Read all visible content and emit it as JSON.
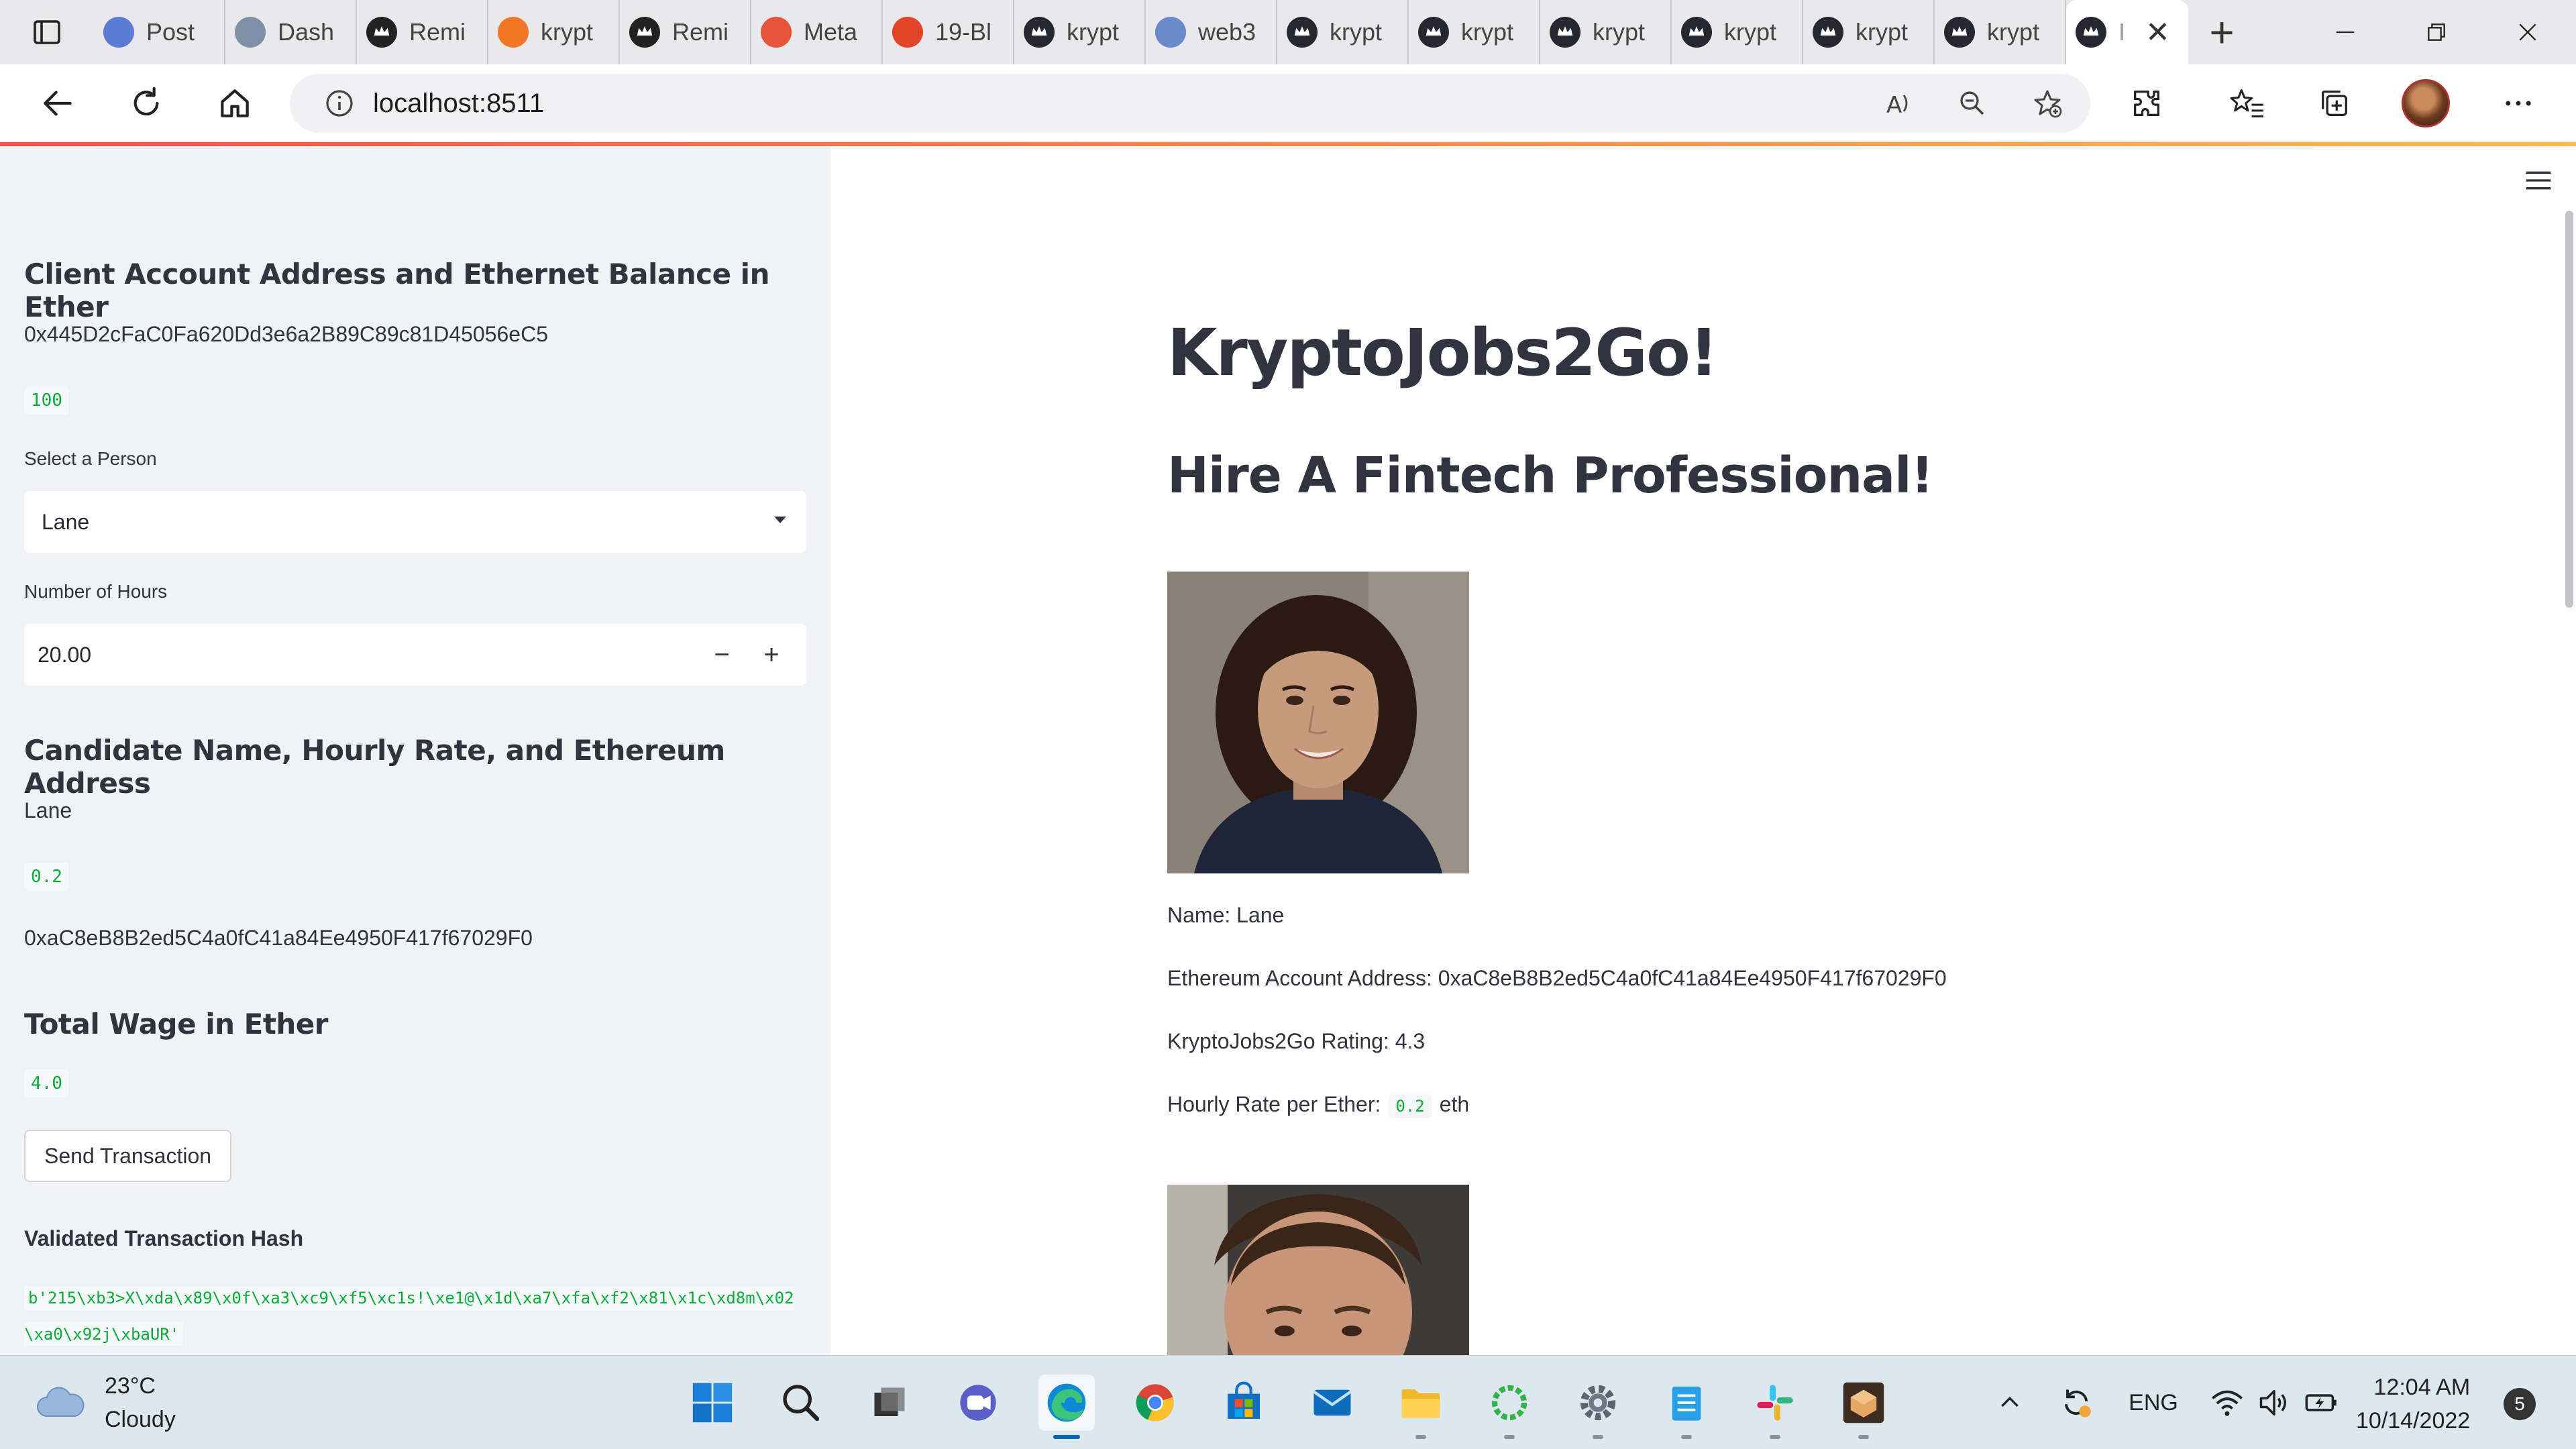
{
  "browser": {
    "tabs": [
      {
        "label": "Post",
        "icon": "postman-icon",
        "color": "#5b7bd5"
      },
      {
        "label": "Dash",
        "icon": "dash-icon",
        "color": "#7f8fa6"
      },
      {
        "label": "Remi",
        "icon": "github-icon",
        "color": "#222222"
      },
      {
        "label": "krypt",
        "icon": "jupyter-icon",
        "color": "#f37626"
      },
      {
        "label": "Remi",
        "icon": "github-icon",
        "color": "#222222"
      },
      {
        "label": "Meta",
        "icon": "rainbow-icon",
        "color": "#e8543a"
      },
      {
        "label": "19-Bl",
        "icon": "gitlab-icon",
        "color": "#e24329"
      },
      {
        "label": "krypt",
        "icon": "streamlit-crown-icon",
        "color": "#262730"
      },
      {
        "label": "web3",
        "icon": "search-icon",
        "color": "#6a8acb"
      },
      {
        "label": "krypt",
        "icon": "streamlit-crown-icon",
        "color": "#262730"
      },
      {
        "label": "krypt",
        "icon": "streamlit-crown-icon",
        "color": "#262730"
      },
      {
        "label": "krypt",
        "icon": "streamlit-crown-icon",
        "color": "#262730"
      },
      {
        "label": "krypt",
        "icon": "streamlit-crown-icon",
        "color": "#262730"
      },
      {
        "label": "krypt",
        "icon": "streamlit-crown-icon",
        "color": "#262730"
      },
      {
        "label": "krypt",
        "icon": "streamlit-crown-icon",
        "color": "#262730"
      }
    ],
    "active_tab": {
      "label": "I",
      "icon": "streamlit-crown-icon"
    },
    "url": "localhost:8511"
  },
  "sidebar": {
    "account_heading": "Client Account Address and Ethernet Balance in Ether",
    "account_address": "0x445D2cFaC0Fa620Dd3e6a2B89C89c81D45056eC5",
    "balance": "100",
    "select_label": "Select a Person",
    "select_value": "Lane",
    "hours_label": "Number of Hours",
    "hours_value": "20.00",
    "hours_minus": "−",
    "hours_plus": "+",
    "candidate_heading": "Candidate Name, Hourly Rate, and Ethereum Address",
    "candidate_name": "Lane",
    "candidate_rate": "0.2",
    "candidate_address": "0xaC8eB8B2ed5C4a0fC41a84Ee4950F417f67029F0",
    "wage_heading": "Total Wage in Ether",
    "wage_value": "4.0",
    "send_button": "Send Transaction",
    "hash_heading": "Validated Transaction Hash",
    "hash_value": "b'215\\xb3>X\\xda\\x89\\x0f\\xa3\\xc9\\xf5\\xc1s!\\xe1@\\x1d\\xa7\\xfa\\xf2\\x81\\x1c\\xd8m\\x02\\xa0\\x92j\\xbaUR'"
  },
  "main": {
    "title": "KryptoJobs2Go!",
    "subtitle": "Hire A Fintech Professional!",
    "candidate": {
      "name_line": "Name: Lane",
      "address_line": "Ethereum Account Address: 0xaC8eB8B2ed5C4a0fC41a84Ee4950F417f67029F0",
      "rating_line": "KryptoJobs2Go Rating: 4.3",
      "rate_prefix": "Hourly Rate per Ether:",
      "rate_value": "0.2",
      "rate_suffix": "eth"
    }
  },
  "taskbar": {
    "weather_temp": "23°C",
    "weather_desc": "Cloudy",
    "language": "ENG",
    "time": "12:04 AM",
    "date": "10/14/2022",
    "notifications": "5"
  },
  "colors": {
    "sidebar_bg": "#f0f2f6",
    "code_green": "#09ab3b",
    "stripe_start": "#ff4b4b",
    "stripe_end": "#ffbd45"
  }
}
